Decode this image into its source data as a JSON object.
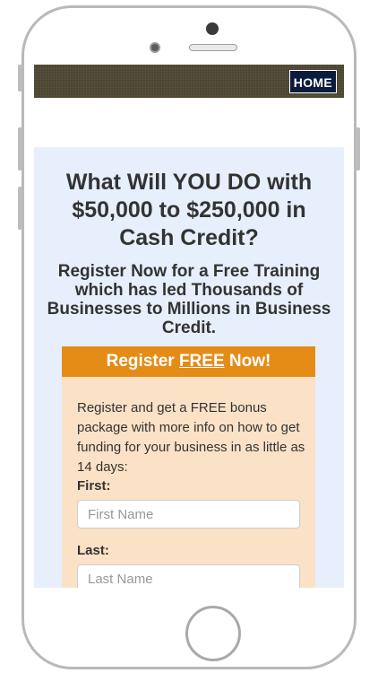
{
  "nav": {
    "home_label": "HOME"
  },
  "hero": {
    "headline": "What Will YOU DO with $50,000 to $250,000 in Cash Credit?",
    "subhead": "Register Now for a Free Training which has led Thousands of Businesses to Millions in Business Credit."
  },
  "form": {
    "cta_prefix": "Register ",
    "cta_free": "FREE",
    "cta_suffix": " Now!",
    "intro": "Register and get a FREE bonus package with more info on how to get funding for your business in as little as 14 days:",
    "first_label": "First:",
    "first_placeholder": "First Name",
    "last_label": "Last:",
    "last_placeholder": "Last Name"
  },
  "colors": {
    "topbar": "#4b4531",
    "home_button": "#0b1a3d",
    "content_bg": "#e7effd",
    "cta_orange": "#e58c16",
    "form_bg": "#fbe1c6"
  }
}
